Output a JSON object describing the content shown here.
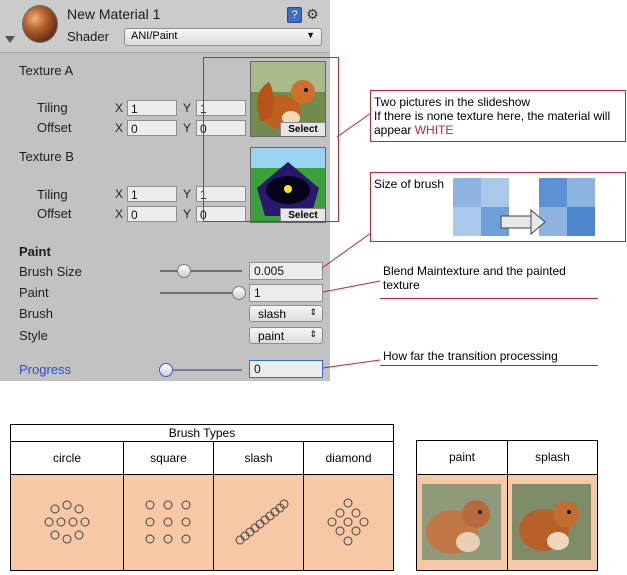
{
  "inspector": {
    "material_name": "New Material 1",
    "shader_label": "Shader",
    "shader_value": "ANI/Paint",
    "texture_a": {
      "label": "Texture A",
      "tiling_label": "Tiling",
      "offset_label": "Offset",
      "tiling_x": "1",
      "tiling_y": "1",
      "offset_x": "0",
      "offset_y": "0",
      "select_label": "Select"
    },
    "texture_b": {
      "label": "Texture B",
      "tiling_label": "Tiling",
      "offset_label": "Offset",
      "tiling_x": "1",
      "tiling_y": "1",
      "offset_x": "0",
      "offset_y": "0",
      "select_label": "Select"
    },
    "axis_x": "X",
    "axis_y": "Y",
    "paint_section": "Paint",
    "brush_size_label": "Brush Size",
    "brush_size_value": "0.005",
    "brush_size_level": 0.15,
    "paint_label": "Paint",
    "paint_value": "1",
    "paint_level": 1.0,
    "brush_label": "Brush",
    "brush_value": "slash",
    "style_label": "Style",
    "style_value": "paint",
    "progress_label": "Progress",
    "progress_value": "0",
    "progress_level": 0.0
  },
  "callouts": {
    "textures_line1": "Two pictures in the slideshow",
    "textures_line2": "If there is none texture here, the material will",
    "textures_line3_prefix": "appear ",
    "textures_line3_highlight": "WHITE",
    "brush_size": "Size of brush",
    "paint": "Blend Maintexture and the painted texture",
    "progress": "How far the transition processing"
  },
  "brush_types": {
    "title": "Brush Types",
    "columns": [
      "circle",
      "square",
      "slash",
      "diamond"
    ]
  },
  "styles": {
    "columns": [
      "paint",
      "splash"
    ]
  },
  "colors": {
    "highlight": "#c1272d",
    "progress_label": "#2a4fd6",
    "peach": "#f7c8a6"
  }
}
